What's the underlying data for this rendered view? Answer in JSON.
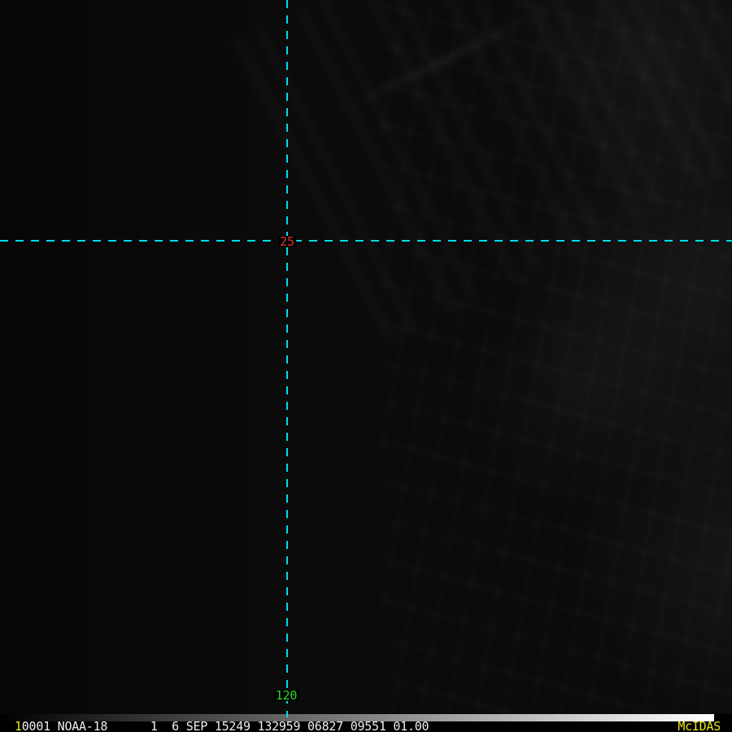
{
  "colors": {
    "cyan": "#00DCE8",
    "red": "#E33030",
    "green": "#2BD62B",
    "yellow": "#E8E818",
    "white": "#EFEFEF",
    "screen-bg": "#0B0B0C"
  },
  "crosshair": {
    "center_label": {
      "text": "25"
    },
    "bottom_label": {
      "text": "120"
    }
  },
  "status_bar": {
    "frame_number": "1",
    "info_text": "0001 NOAA-18      1  6 SEP 15249 132959 06827 09551 01.00",
    "brand": "McIDAS"
  }
}
